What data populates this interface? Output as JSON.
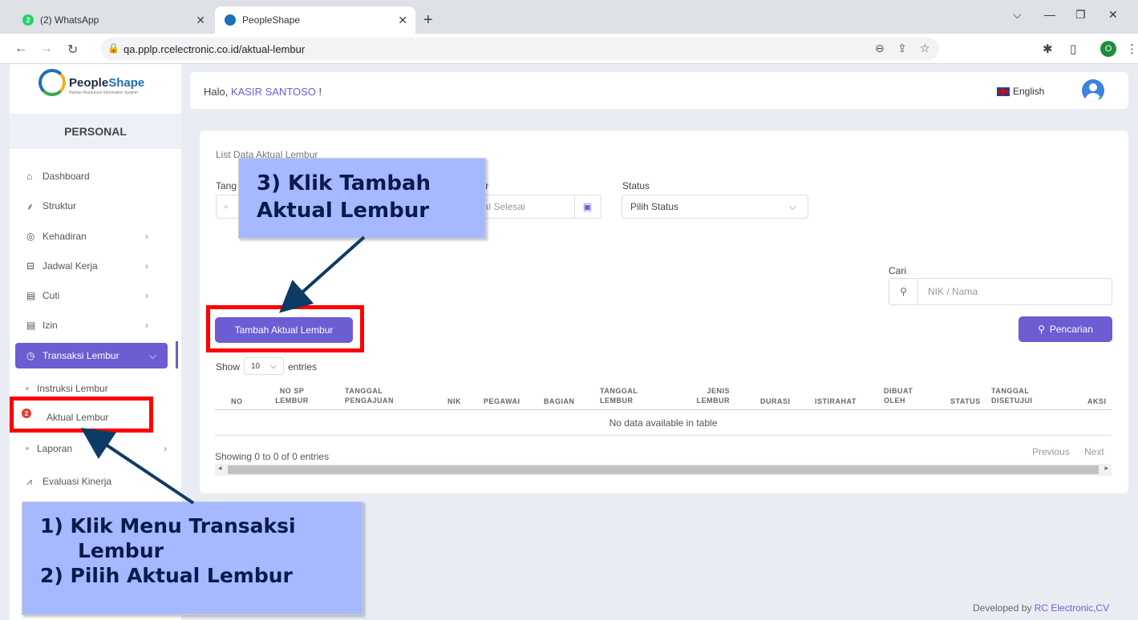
{
  "browser": {
    "tabs": [
      {
        "label": "(2) WhatsApp",
        "badge": "2"
      },
      {
        "label": "PeopleShape"
      }
    ],
    "url": "qa.pplp.rcelectronic.co.id/aktual-lembur",
    "profile_initial": "O"
  },
  "sidebar": {
    "logo_name_a": "People",
    "logo_name_b": "Shape",
    "logo_sub": "Human Resources Information System",
    "section": "PERSONAL",
    "items": [
      {
        "label": "Dashboard",
        "icon": "home-icon"
      },
      {
        "label": "Struktur",
        "icon": "hierarchy-icon"
      },
      {
        "label": "Kehadiran",
        "icon": "fingerprint-icon"
      },
      {
        "label": "Jadwal Kerja",
        "icon": "briefcase-icon"
      },
      {
        "label": "Cuti",
        "icon": "calendar-icon"
      },
      {
        "label": "Izin",
        "icon": "calendar-icon"
      },
      {
        "label": "Transaksi Lembur",
        "icon": "clock-icon"
      }
    ],
    "sub_items": [
      "Instruksi Lembur",
      "Aktual Lembur",
      "Laporan"
    ],
    "bottom_item": "Evaluasi Kinerja",
    "badge": "2"
  },
  "header": {
    "greeting": "Halo, ",
    "user": "KASIR SANTOSO",
    "greeting_end": " !",
    "language": "English"
  },
  "card": {
    "title": "List Data Aktual Lembur",
    "date_label_start": "Tang",
    "date_label_end": "hir",
    "date_end_placeholder": "gal Selesai",
    "status_label": "Status",
    "status_value": "Pilih Status",
    "search_label": "Cari",
    "search_placeholder": "NIK / Nama",
    "add_button": "Tambah Aktual Lembur",
    "search_button": "Pencarian",
    "show_label": "Show",
    "show_value": "10",
    "entries_label": "entries",
    "columns": [
      "NO",
      "NO SP LEMBUR",
      "TANGGAL PENGAJUAN",
      "NIK",
      "PEGAWAI",
      "BAGIAN",
      "TANGGAL LEMBUR",
      "JENIS LEMBUR",
      "DURASI",
      "ISTIRAHAT",
      "DIBUAT OLEH",
      "STATUS",
      "TANGGAL DISETUJUI",
      "AKSI"
    ],
    "empty_text": "No data available in table",
    "info": "Showing 0 to 0 of 0 entries",
    "prev": "Previous",
    "next": "Next"
  },
  "footer": {
    "text": "Developed by ",
    "link": "RC Electronic,CV"
  },
  "annotations": {
    "note_top_line1": "3) Klik Tambah",
    "note_top_line2": "Aktual Lembur",
    "note_bottom_line1": "1) Klik Menu Transaksi",
    "note_bottom_line2": "Lembur",
    "note_bottom_line3": "2) Pilih Aktual Lembur"
  }
}
